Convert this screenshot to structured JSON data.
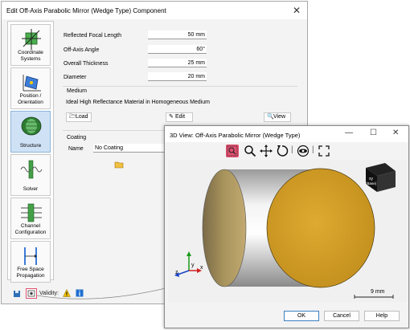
{
  "main_dialog": {
    "title": "Edit Off-Axis Parabolic Mirror (Wedge Type) Component",
    "nav": [
      {
        "label_1": "Coordinate",
        "label_2": "Systems"
      },
      {
        "label_1": "Position /",
        "label_2": "Orientation"
      },
      {
        "label_1": "Structure",
        "label_2": ""
      },
      {
        "label_1": "Solver",
        "label_2": ""
      },
      {
        "label_1": "Channel",
        "label_2": "Configuration"
      },
      {
        "label_1": "Free Space",
        "label_2": "Propagation"
      }
    ],
    "fields": [
      {
        "label": "Reflected Focal Length",
        "value": "50 mm"
      },
      {
        "label": "Off-Axis Angle",
        "value": "60°"
      },
      {
        "label": "Overall Thickness",
        "value": "25 mm"
      },
      {
        "label": "Diameter",
        "value": "20 mm"
      }
    ],
    "medium": {
      "title": "Medium",
      "description": "Ideal High Reflectance Material in Homogeneous Medium",
      "load_label": "Load",
      "edit_label": "Edit",
      "view_label": "View"
    },
    "coating": {
      "title": "Coating",
      "name_label": "Name",
      "name_value": "No Coating"
    },
    "bottom": {
      "validity_label": "Validity:"
    }
  },
  "view3d": {
    "title": "3D View: Off-Axis Parabolic Mirror (Wedge Type)",
    "scale_label": "9 mm",
    "axis_y": "y",
    "axis_z": "z",
    "axis_x": "x",
    "cube_label_1": "xy",
    "cube_label_2": "(Base)",
    "ok_label": "OK",
    "cancel_label": "Cancel",
    "help_label": "Help"
  },
  "colors": {
    "accent": "#3d7fc4",
    "mirror_gold": "#d4a22a",
    "mirror_back": "#a8945c",
    "active_nav": "#cfe2f5",
    "highlight_red": "#e05070"
  }
}
